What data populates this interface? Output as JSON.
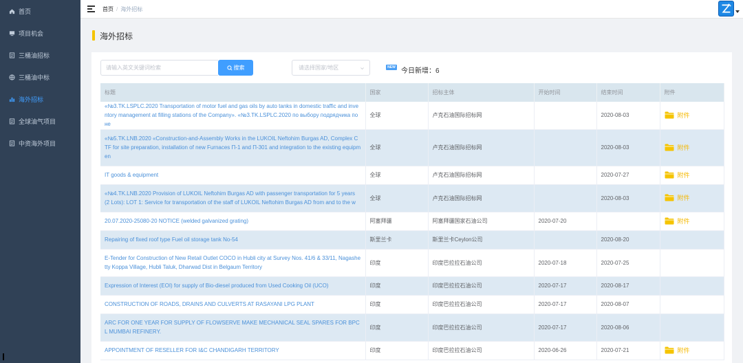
{
  "sidebar": {
    "items": [
      {
        "label": "首页",
        "icon": "home-icon",
        "active": false
      },
      {
        "label": "项目机会",
        "icon": "monitor-icon",
        "active": false
      },
      {
        "label": "三桶油招标",
        "icon": "document-icon",
        "active": false
      },
      {
        "label": "三桶油中标",
        "icon": "globe-icon",
        "active": false
      },
      {
        "label": "海外招标",
        "icon": "bar-chart-icon",
        "active": true
      },
      {
        "label": "全球油气项目",
        "icon": "document-icon",
        "active": false
      },
      {
        "label": "中资海外项目",
        "icon": "document-icon",
        "active": false
      }
    ]
  },
  "header": {
    "breadcrumb_home": "首页",
    "breadcrumb_sep": "/",
    "breadcrumb_current": "海外招标"
  },
  "page": {
    "title": "海外招标"
  },
  "filters": {
    "search_placeholder": "请输入英文关键词检索",
    "search_button": "搜索",
    "country_placeholder": "请选择国家/地区",
    "new_badge": "NEW",
    "today_new": "今日新增：6"
  },
  "table": {
    "columns": [
      "标题",
      "国家",
      "招标主体",
      "开始时间",
      "结束时间",
      "附件"
    ],
    "attachment_label": "附件",
    "rows": [
      {
        "title": "«№3.TK.LSPLC.2020 Transportation of motor fuel and gas oils by auto tanks in domestic traffic and inventory management at filling stations of the Company». «№3.TK.LSPLC.2020 по выбору подрядчика по не",
        "country": "全球",
        "org": "卢克石油国际招标网",
        "start": "",
        "end": "2020-08-03",
        "attachment": true
      },
      {
        "title": "«№5.TK.LNB.2020 «Construction-and-Assembly Works in the LUKOIL Neftohim Burgas AD, Complex CTF for site preparation, installation of new Furnaces П-1 and П-301 and integration to the existing equipmen",
        "country": "全球",
        "org": "卢克石油国际招标网",
        "start": "",
        "end": "2020-08-03",
        "attachment": true
      },
      {
        "title": "IT goods & equipment",
        "country": "全球",
        "org": "卢克石油国际招标网",
        "start": "",
        "end": "2020-07-27",
        "attachment": true
      },
      {
        "title": "«№4.TK.LNB.2020 Provision of LUKOIL Neftohim Burgas AD with passenger transportation for 5 years (2 Lots): LOT 1: Service for transportation of the staff of LUKOIL Neftohim Burgas AD from and to the w",
        "country": "全球",
        "org": "卢克石油国际招标网",
        "start": "",
        "end": "2020-08-03",
        "attachment": true
      },
      {
        "title": "20.07.2020-25080-20 NOTICE (welded galvanized grating)",
        "country": "阿塞拜疆",
        "org": "阿塞拜疆国家石油公司",
        "start": "2020-07-20",
        "end": "",
        "attachment": true
      },
      {
        "title": "Repairing of fixed roof type Fuel oil storage tank No-54",
        "country": "斯里兰卡",
        "org": "斯里兰卡Ceylon公司",
        "start": "",
        "end": "2020-08-20",
        "attachment": false
      },
      {
        "title": "E-Tender for Construction of New Retail Outlet COCO in Hubli city at Survey Nos. 41/6 & 33/11, Nagashetty Koppa Village, Hubli Taluk, Dharwad Dist in Belgaum Territory",
        "country": "印度",
        "org": "印度巴拉拉石油公司",
        "start": "2020-07-18",
        "end": "2020-07-25",
        "attachment": false
      },
      {
        "title": "Expression of Interest (EOI) for supply of Bio-diesel produced from Used Cooking Oil (UCO)",
        "country": "印度",
        "org": "印度巴拉拉石油公司",
        "start": "2020-07-17",
        "end": "2020-08-17",
        "attachment": false
      },
      {
        "title": "CONSTRUCTION OF ROADS, DRAINS AND CULVERTS AT RASAYANI LPG PLANT",
        "country": "印度",
        "org": "印度巴拉拉石油公司",
        "start": "2020-07-17",
        "end": "2020-08-07",
        "attachment": false
      },
      {
        "title": "ARC FOR ONE YEAR FOR SUPPLY OF FLOWSERVE MAKE MECHANICAL SEAL SPARES FOR BPCL MUMBAI REFINERY.",
        "country": "印度",
        "org": "印度巴拉拉石油公司",
        "start": "2020-07-17",
        "end": "2020-08-06",
        "attachment": false
      },
      {
        "title": "APPOINTMENT OF RESELLER FOR I&C CHANDIGARH TERRITORY",
        "country": "印度",
        "org": "印度巴拉拉石油公司",
        "start": "2020-06-26",
        "end": "2020-07-21",
        "attachment": true
      }
    ]
  }
}
